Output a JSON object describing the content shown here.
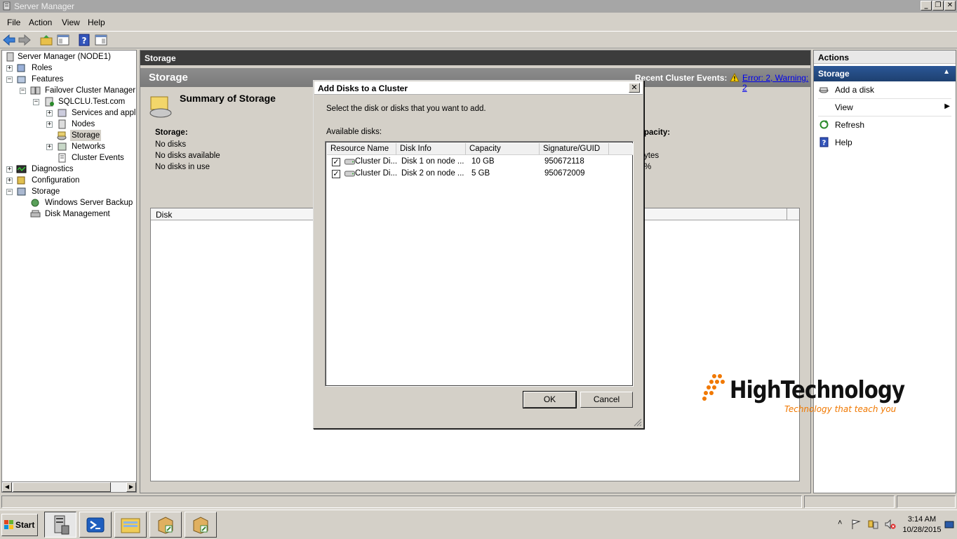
{
  "window": {
    "title": "Server Manager"
  },
  "menu": [
    "File",
    "Action",
    "View",
    "Help"
  ],
  "tree": {
    "items": [
      {
        "label": "Server Manager (NODE1)"
      },
      {
        "label": "Roles"
      },
      {
        "label": "Features"
      },
      {
        "label": "Failover Cluster Manager"
      },
      {
        "label": "SQLCLU.Test.com"
      },
      {
        "label": "Services and applications"
      },
      {
        "label": "Nodes"
      },
      {
        "label": "Storage"
      },
      {
        "label": "Networks"
      },
      {
        "label": "Cluster Events"
      },
      {
        "label": "Diagnostics"
      },
      {
        "label": "Configuration"
      },
      {
        "label": "Storage"
      },
      {
        "label": "Windows Server Backup"
      },
      {
        "label": "Disk Management"
      }
    ]
  },
  "center": {
    "header": "Storage",
    "title": "Storage",
    "recent_events_label": "Recent Cluster Events:",
    "recent_events_link": "Error: 2, Warning: 2",
    "summary_title": "Summary of Storage",
    "storage_label": "Storage:",
    "storage_lines": [
      "No disks",
      "No disks available",
      "No disks in use"
    ],
    "capacity_label_partial": "pacity:",
    "capacity_value_partial": "ytes",
    "percent_partial": "%",
    "disk_column": "Disk"
  },
  "dialog": {
    "title": "Add Disks to a Cluster",
    "prompt": "Select the disk or disks that you want to add.",
    "available_label": "Available disks:",
    "columns": [
      "Resource Name",
      "Disk Info",
      "Capacity",
      "Signature/GUID"
    ],
    "rows": [
      {
        "checked": true,
        "name": "Cluster Di...",
        "info": "Disk 1 on node ...",
        "capacity": "10 GB",
        "signature": "950672118"
      },
      {
        "checked": true,
        "name": "Cluster Di...",
        "info": "Disk 2 on node ...",
        "capacity": "5 GB",
        "signature": "950672009"
      }
    ],
    "ok_label": "OK",
    "cancel_label": "Cancel"
  },
  "actions": {
    "header": "Actions",
    "section": "Storage",
    "items": [
      {
        "label": "Add a disk"
      },
      {
        "label": "View"
      },
      {
        "label": "Refresh"
      },
      {
        "label": "Help"
      }
    ]
  },
  "taskbar": {
    "start_label": "Start",
    "time": "3:14 AM",
    "date": "10/28/2015"
  },
  "watermark": {
    "title": "HighTechnology",
    "tagline": "Technology that teach you"
  },
  "colors": {
    "accent": "#2b5797",
    "link": "#0000ee",
    "watermark_orange": "#f07800"
  }
}
